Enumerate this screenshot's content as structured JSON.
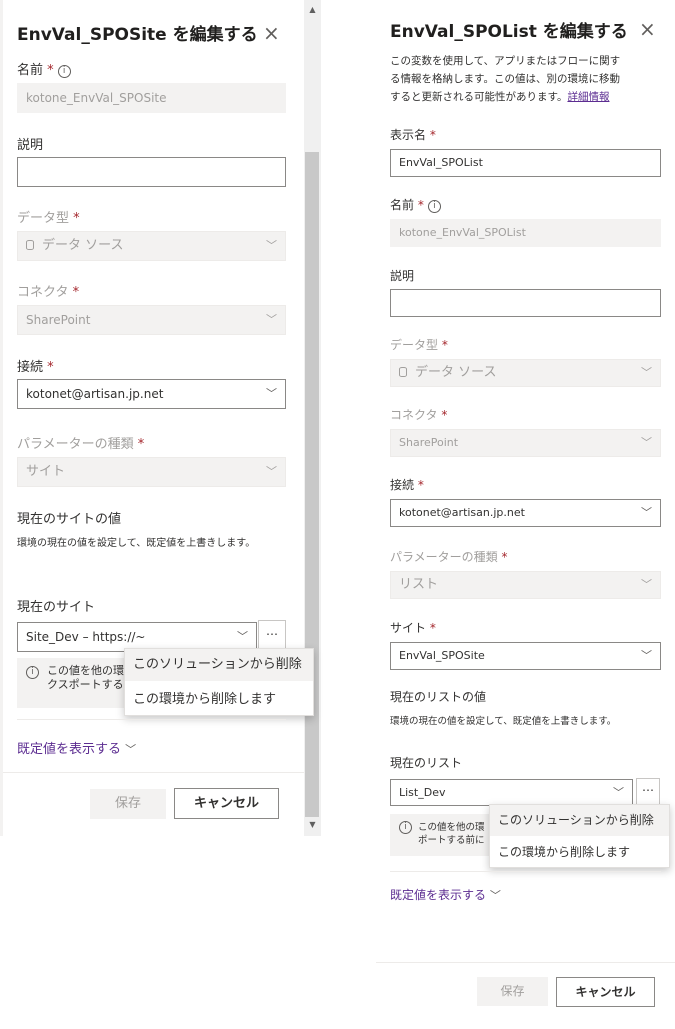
{
  "left": {
    "title": "EnvVal_SPOSite を編集する",
    "close_glyph": "×",
    "name_label": "名前",
    "name_value": "kotone_EnvVal_SPOSite",
    "desc_label": "説明",
    "desc_value": "",
    "datatype_label": "データ型",
    "datatype_value": "データ ソース",
    "connector_label": "コネクタ",
    "connector_value": "SharePoint",
    "connection_label": "接続",
    "connection_value": "kotonet@artisan.jp.net",
    "paramtype_label": "パラメーターの種類",
    "paramtype_value": "サイト",
    "current_header": "現在のサイトの値",
    "current_desc": "環境の現在の値を設定して、既定値を上書きします。",
    "current_label": "現在のサイト",
    "current_value": "Site_Dev – https://~",
    "more_glyph": "⋯",
    "msg_text_line1": "この値を他の環",
    "msg_text_line2": "クスポートする",
    "menu_items": [
      "このソリューションから削除",
      "この環境から削除します"
    ],
    "show_default": "既定値を表示する",
    "save": "保存",
    "cancel": "キャンセル"
  },
  "right": {
    "title": "EnvVal_SPOList を編集する",
    "close_glyph": "×",
    "intro_line1": "この変数を使用して、アプリまたはフローに関す",
    "intro_line2": "る情報を格納します。この値は、別の環境に移動",
    "intro_line3": "すると更新される可能性があります。",
    "intro_link": "詳細情報",
    "display_label": "表示名",
    "display_value": "EnvVal_SPOList",
    "name_label": "名前",
    "name_value": "kotone_EnvVal_SPOList",
    "desc_label": "説明",
    "desc_value": "",
    "datatype_label": "データ型",
    "datatype_value": "データ ソース",
    "connector_label": "コネクタ",
    "connector_value": "SharePoint",
    "connection_label": "接続",
    "connection_value": "kotonet@artisan.jp.net",
    "paramtype_label": "パラメーターの種類",
    "paramtype_value": "リスト",
    "site_label": "サイト",
    "site_value": "EnvVal_SPOSite",
    "current_header": "現在のリストの値",
    "current_desc": "環境の現在の値を設定して、既定値を上書きします。",
    "current_label": "現在のリスト",
    "current_value": "List_Dev",
    "more_glyph": "⋯",
    "msg_text_line1": "この値を他の環",
    "msg_text_line2": "ポートする前に",
    "menu_items": [
      "このソリューションから削除",
      "この環境から削除します"
    ],
    "show_default": "既定値を表示する",
    "save": "保存",
    "cancel": "キャンセル"
  },
  "required_mark": "*",
  "info_glyph": "i",
  "chevron_glyph": "﹀",
  "colors": {
    "required": "#a4262c",
    "link": "#5c2d91",
    "disabled_bg": "#f3f2f1",
    "disabled_text": "#a19f9d"
  }
}
